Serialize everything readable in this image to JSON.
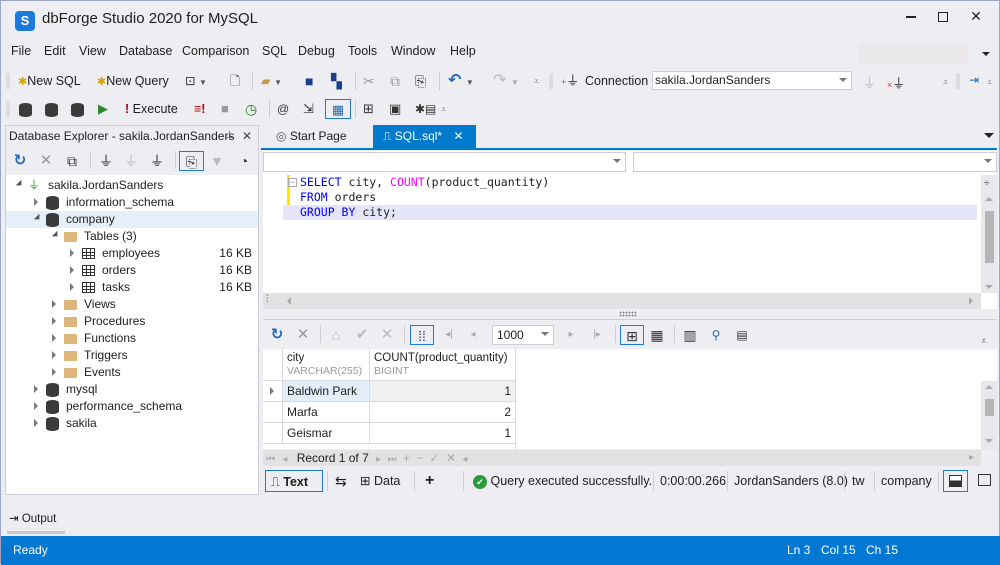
{
  "window": {
    "title": "dbForge Studio 2020 for MySQL",
    "logo_letter": "S",
    "minimize": "—",
    "maximize": "☐",
    "close": "✕"
  },
  "menu": [
    "File",
    "Edit",
    "View",
    "Database",
    "Comparison",
    "SQL",
    "Debug",
    "Tools",
    "Window",
    "Help"
  ],
  "toolbar1": {
    "new_sql": "New SQL",
    "new_query": "New Query",
    "connection_label": "Connection",
    "connection_value": "sakila.JordanSanders"
  },
  "toolbar2": {
    "execute": "Execute"
  },
  "explorer": {
    "title": "Database Explorer - sakila.JordanSanders",
    "pin": "⊥",
    "close": "✕",
    "tree": [
      {
        "label": "sakila.JordanSanders",
        "level": 0,
        "type": "connection",
        "expanded": true
      },
      {
        "label": "information_schema",
        "level": 1,
        "type": "database",
        "expanded": false
      },
      {
        "label": "company",
        "level": 1,
        "type": "database",
        "expanded": true,
        "selected": true
      },
      {
        "label": "Tables (3)",
        "level": 2,
        "type": "folder-open",
        "expanded": true
      },
      {
        "label": "employees",
        "level": 3,
        "type": "table",
        "size": "16 KB"
      },
      {
        "label": "orders",
        "level": 3,
        "type": "table",
        "size": "16 KB"
      },
      {
        "label": "tasks",
        "level": 3,
        "type": "table",
        "size": "16 KB"
      },
      {
        "label": "Views",
        "level": 2,
        "type": "folder"
      },
      {
        "label": "Procedures",
        "level": 2,
        "type": "folder"
      },
      {
        "label": "Functions",
        "level": 2,
        "type": "folder"
      },
      {
        "label": "Triggers",
        "level": 2,
        "type": "folder"
      },
      {
        "label": "Events",
        "level": 2,
        "type": "folder"
      },
      {
        "label": "mysql",
        "level": 1,
        "type": "database"
      },
      {
        "label": "performance_schema",
        "level": 1,
        "type": "database"
      },
      {
        "label": "sakila",
        "level": 1,
        "type": "database"
      }
    ]
  },
  "tabs": [
    {
      "label": "Start Page",
      "active": false
    },
    {
      "label": "SQL.sql*",
      "active": true,
      "close": "✕"
    }
  ],
  "editor": {
    "lines": [
      [
        {
          "t": "SELECT",
          "c": "kw"
        },
        {
          "t": " city, ",
          "c": ""
        },
        {
          "t": "COUNT",
          "c": "fn"
        },
        {
          "t": "(product_quantity)",
          "c": ""
        }
      ],
      [
        {
          "t": "FROM",
          "c": "kw"
        },
        {
          "t": " orders",
          "c": ""
        }
      ],
      [
        {
          "t": "GROUP BY",
          "c": "kw"
        },
        {
          "t": " city;",
          "c": ""
        }
      ]
    ]
  },
  "grid_toolbar": {
    "page_size": "1000"
  },
  "grid": {
    "columns": [
      {
        "name": "city",
        "type": "VARCHAR(255)"
      },
      {
        "name": "COUNT(product_quantity)",
        "type": "BIGINT"
      }
    ],
    "rows": [
      [
        "Baldwin Park",
        "1"
      ],
      [
        "Marfa",
        "2"
      ],
      [
        "Geismar",
        "1"
      ]
    ],
    "record_text": "Record 1 of 7"
  },
  "bottom": {
    "text_btn": "Text",
    "data_btn": "Data",
    "add_btn": "+",
    "status": "Query executed successfully.",
    "elapsed": "0:00:00.266",
    "user": "JordanSanders (8.0)",
    "host": "tw",
    "database": "company"
  },
  "output_label": "Output",
  "statusbar": {
    "left": "Ready",
    "ln": "Ln 3",
    "col": "Col 15",
    "ch": "Ch 15"
  },
  "colors": {
    "accent": "#007acc",
    "statusbar": "#0278d3",
    "keyword": "#0000ff",
    "function": "#ff00ff"
  }
}
